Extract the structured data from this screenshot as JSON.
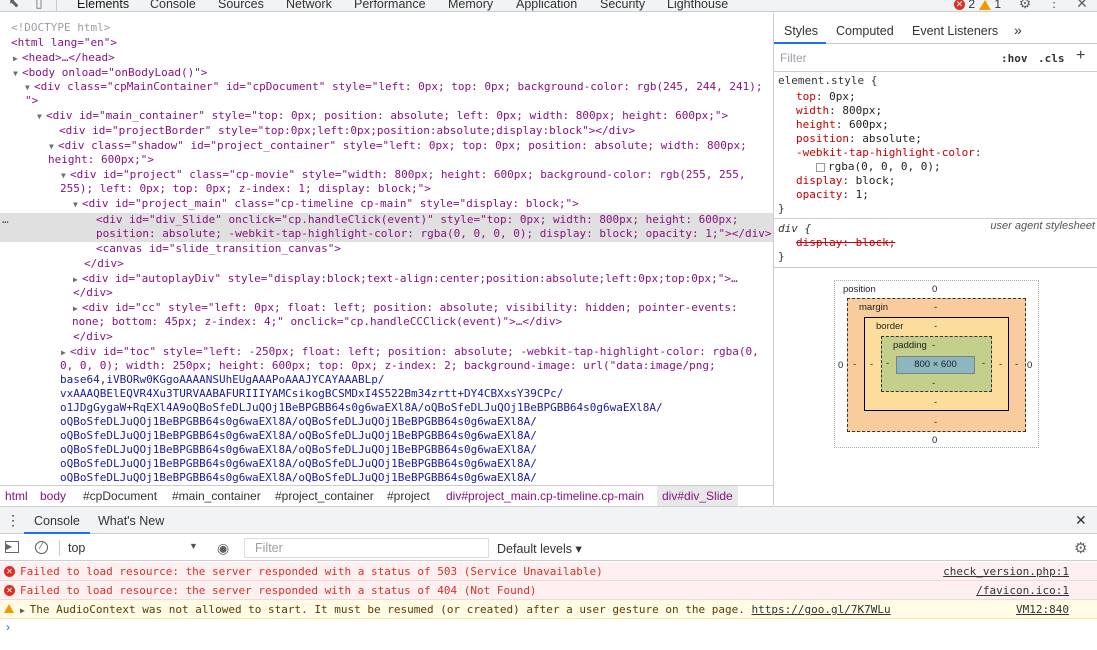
{
  "toolbar": {
    "tabs": [
      "Elements",
      "Console",
      "Sources",
      "Network",
      "Performance",
      "Memory",
      "Application",
      "Security",
      "Lighthouse"
    ],
    "errors_count": "2",
    "warnings_count": "1"
  },
  "dom": {
    "lines": [
      "<!DOCTYPE html>",
      "<html lang=\"en\">",
      "<head>…</head>",
      "<body onload=\"onBodyLoad()\">",
      "<div class=\"cpMainContainer\" id=\"cpDocument\" style=\"left: 0px; top: 0px; background-color: rgb(245, 244, 241);",
      "\">",
      "<div id=\"main_container\" style=\"top: 0px; position: absolute; left: 0px; width: 800px; height: 600px;\">",
      "<div id=\"projectBorder\" style=\"top:0px;left:0px;position:absolute;display:block\"></div>",
      "<div class=\"shadow\" id=\"project_container\" style=\"left: 0px; top: 0px; position: absolute; width: 800px;",
      "height: 600px;\">",
      "<div id=\"project\" class=\"cp-movie\" style=\"width: 800px; height: 600px; background-color: rgb(255, 255,",
      "255); left: 0px; top: 0px; z-index: 1; display: block;\">",
      "<div id=\"project_main\" class=\"cp-timeline cp-main\" style=\"display: block;\">",
      "<div id=\"div_Slide\" onclick=\"cp.handleClick(event)\" style=\"top: 0px; width: 800px; height: 600px;",
      "position: absolute; -webkit-tap-highlight-color: rgba(0, 0, 0, 0); display: block; opacity: 1;\"></div>",
      "<canvas id=\"slide_transition_canvas\">",
      "</div>",
      "<div id=\"autoplayDiv\" style=\"display:block;text-align:center;position:absolute;left:0px;top:0px;\">…",
      "</div>",
      "<div id=\"cc\" style=\"left: 0px; float: left; position: absolute; visibility: hidden; pointer-events:",
      "none; bottom: 45px; z-index: 4;\" onclick=\"cp.handleCCClick(event)\">…</div>",
      "</div>",
      "<div id=\"toc\" style=\"left: -250px; float: left; position: absolute; -webkit-tap-highlight-color: rgba(0,",
      "0, 0, 0); width: 250px; height: 600px; top: 0px; z-index: 2; background-image: url(\"data:image/png;",
      "base64,iVBORw0KGgoAAAANSUhEUgAAAPoAAAJYCAYAAABLp/",
      "vxAAAQBElEQVR4Xu3TURVAABAFURIIIYAMCsikogBCSMDxI4S522Bm34zrtt+DY4CBXxsY39CPc/",
      "o1JDgGygaW+RqEXl4A9oQBoSfeDLJuQOj1BeBPGBB64s0g6waEXl8A/oQBoSfeDLJuQOj1BeBPGBB64s0g6waEXl8A/",
      "oQBoSfeDLJuQOj1BeBPGBB64s0g6waEXl8A/oQBoSfeDLJuQOj1BeBPGBB64s0g6waEXl8A/",
      "oQBoSfeDLJuQOj1BeBPGBB64s0g6waEXl8A/oQBoSfeDLJuQOj1BeBPGBB64s0g6waEXl8A/",
      "oQBoSfeDLJuQOj1BeBPGBB64s0g6waEXl8A/oQBoSfeDLJuQOj1BeBPGBB64s0g6waEXl8A/",
      "oQBoSfeDLJuQOj1BeBPGBB64s0g6waEXl8A/oQBoSfeDLJuQOj1BeBPGBB64s0g6waEXl8A/",
      "oQBoSfeDLJuQOj1BeBPGBB64s0g6waEXl8A/oQBoSfeDLJuQOj1BeBPGBB64s0g6waEXl8A/"
    ],
    "selected_marker": "…"
  },
  "breadcrumbs": [
    "html",
    "body",
    "#cpDocument",
    "#main_container",
    "#project_container",
    "#project",
    "div#project_main.cp-timeline.cp-main",
    "div#div_Slide"
  ],
  "styles": {
    "tabs": [
      "Styles",
      "Computed",
      "Event Listeners",
      "»"
    ],
    "filter_placeholder": "Filter",
    "hov": ":hov",
    "cls": ".cls",
    "plus": "+",
    "element_style_selector": "element.style {",
    "props": [
      {
        "name": "top",
        "value": "0px;"
      },
      {
        "name": "width",
        "value": "800px;"
      },
      {
        "name": "height",
        "value": "600px;"
      },
      {
        "name": "position",
        "value": "absolute;"
      },
      {
        "name": "-webkit-tap-highlight-color",
        "value": ""
      },
      {
        "name": "",
        "value": "rgba(0, 0, 0, 0);"
      },
      {
        "name": "display",
        "value": "block;"
      },
      {
        "name": "opacity",
        "value": "1;"
      }
    ],
    "close_brace": "}",
    "ua_selector": "div {",
    "ua_label": "user agent stylesheet",
    "ua_prop": "display: block;",
    "box_model": {
      "position_label": "position",
      "position_value": "0",
      "margin_label": "margin",
      "border_label": "border",
      "padding_label": "padding",
      "dash": "-",
      "content": "800 × 600",
      "left_value": "0",
      "right_value": "0",
      "bottom_value": "0"
    }
  },
  "drawer": {
    "tabs": [
      "Console",
      "What's New"
    ],
    "context": "top",
    "filter_placeholder": "Filter",
    "levels": "Default levels ▾"
  },
  "console": {
    "messages": [
      {
        "type": "error",
        "text": "Failed to load resource: the server responded with a status of 503 (Service Unavailable)",
        "source": "check_version.php:1"
      },
      {
        "type": "error",
        "text": "Failed to load resource: the server responded with a status of 404 (Not Found)",
        "source": "/favicon.ico:1"
      },
      {
        "type": "warning",
        "text": "The AudioContext was not allowed to start. It must be resumed (or created) after a user gesture on the page.",
        "link": "https://goo.gl/7K7WLu",
        "source": "VM12:840"
      }
    ],
    "prompt": "›"
  }
}
